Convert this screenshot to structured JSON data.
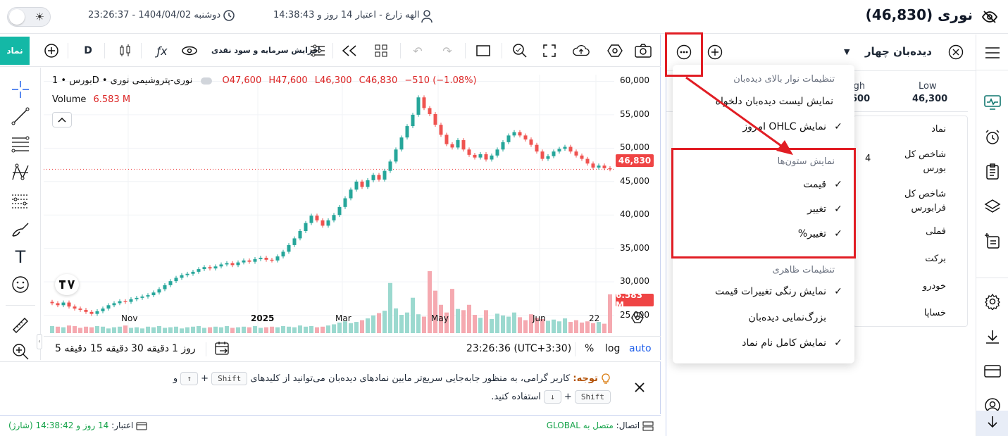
{
  "header": {
    "title": "نوری (46,830)",
    "user": "الهه زارع - اعتبار 14 روز و 14:38:43",
    "datetime": "دوشنبه 1404/04/02 - 23:26:37"
  },
  "toolbar": {
    "namad_label": "نماد",
    "interval": "D",
    "capital_label": "افزایش سرمایه و سود نقدی"
  },
  "chart_legend": {
    "symbol": "بورس • 1D • نوری-پتروشیمی نوری",
    "o": "O47,600",
    "h": "H47,600",
    "l": "L46,300",
    "c": "C46,830",
    "chg": "−510 (−1.08%)",
    "volume_label": "Volume",
    "volume_value": "6.583 M"
  },
  "chart_data": {
    "type": "candlestick",
    "ylim": [
      22000,
      61000
    ],
    "y_ticks": [
      "60,000",
      "55,000",
      "50,000",
      "45,000",
      "40,000",
      "35,000",
      "30,000",
      "25,000"
    ],
    "x_ticks": [
      "Nov",
      "2025",
      "Mar",
      "May",
      "Jun",
      "22"
    ],
    "last_price_label": "46,830",
    "last_volume_label": "6.583 M",
    "close_series": [
      26800,
      26500,
      26900,
      26300,
      26000,
      25800,
      25500,
      25200,
      25600,
      26000,
      26500,
      26800,
      27100,
      27000,
      27400,
      27600,
      27800,
      28000,
      28400,
      28900,
      29500,
      30100,
      30600,
      31000,
      31200,
      31500,
      31900,
      32200,
      32000,
      32300,
      32600,
      32800,
      32500,
      32900,
      33200,
      33000,
      33400,
      33600,
      33300,
      33200,
      33800,
      34500,
      35500,
      36500,
      37600,
      38800,
      39900,
      39200,
      38400,
      39200,
      40000,
      41200,
      42500,
      43800,
      45000,
      44200,
      45200,
      46000,
      45300,
      46600,
      48000,
      49800,
      51600,
      53300,
      55000,
      57600,
      56000,
      55100,
      53500,
      52000,
      50600,
      50100,
      51200,
      49800,
      49000,
      48600,
      49100,
      48300,
      48900,
      49800,
      50900,
      51900,
      52400,
      51900,
      51300,
      50500,
      49500,
      48400,
      48800,
      49500,
      49900,
      50200,
      49500,
      48900,
      48400,
      47700,
      47100,
      47400,
      47000,
      46830
    ],
    "volume_series": [
      1.2,
      1.1,
      1.0,
      1.3,
      1.2,
      0.9,
      1.1,
      1.0,
      1.2,
      1.1,
      0.8,
      1.0,
      1.1,
      1.3,
      0.9,
      1.0,
      0.8,
      1.1,
      1.0,
      1.2,
      0.9,
      1.0,
      1.1,
      0.8,
      1.0,
      1.1,
      1.2,
      0.9,
      1.0,
      1.1,
      1.0,
      1.2,
      0.9,
      1.0,
      1.1,
      1.0,
      1.2,
      0.9,
      1.0,
      1.1,
      1.0,
      1.2,
      1.1,
      1.0,
      1.3,
      1.1,
      1.2,
      1.0,
      1.1,
      1.3,
      1.5,
      1.8,
      2.0,
      1.7,
      1.9,
      2.2,
      2.5,
      3.0,
      3.4,
      3.8,
      8.5,
      4.2,
      3.1,
      3.5,
      6.0,
      3.2,
      2.8,
      10.5,
      7.2,
      4.8,
      3.5,
      7.5,
      4.1,
      3.9,
      4.8,
      3.1,
      2.6,
      3.9,
      2.4,
      3.3,
      3.0,
      2.8,
      3.5,
      2.7,
      2.2,
      3.2,
      2.6,
      2.4,
      2.1,
      2.3,
      2.0,
      2.5,
      1.9,
      2.2,
      1.8,
      2.0,
      1.7,
      1.9,
      1.6,
      6.583
    ]
  },
  "timeframes": [
    "5 دقیقه",
    "15 دقیقه",
    "30 دقیقه",
    "1 روز"
  ],
  "time_display": "23:26:36 (UTC+3:30)",
  "scale": {
    "pct": "%",
    "log": "log",
    "auto": "auto"
  },
  "notice": {
    "title": "توجه:",
    "text1": "کاربر گرامی، به منظور جابه‌جایی سریع‌تر مابین نمادهای دیده‌بان می‌توانید از کلیدهای",
    "text2": "استفاده کنید.",
    "key_shift": "Shift",
    "plus": "+",
    "and": "و",
    "arrow_up": "↑",
    "arrow_down": "↓"
  },
  "status": {
    "connection_label": "اتصال:",
    "connection_value": "متصل به GLOBAL",
    "credit_label": "اعتبار:",
    "credit_value": "14 روز و 14:38:42 (شارژ)"
  },
  "watchlist": {
    "title": "دیده‌بان چهار",
    "col_high_part": "igh",
    "col_low": "Low",
    "high_val_part": "600",
    "low_val": "46,300",
    "col_namad": "نماد",
    "rows": [
      "شاخص کل بورس",
      "شاخص کل فرابورس",
      "فملی",
      "برکت",
      "خودرو",
      "خساپا"
    ],
    "row_fragment": "4"
  },
  "menu": {
    "header1": "تنظیمات نوار بالای دیده‌بان",
    "item1": "نمایش لیست دیده‌بان دلخواه",
    "item2": "نمایش OHLC امروز",
    "header2": "نمایش ستون‌ها",
    "item3": "قیمت",
    "item4": "تغییر",
    "item5": "تغییر%",
    "header3": "تنظیمات ظاهری",
    "item6": "نمایش رنگی تغییرات قیمت",
    "item7": "بزرگ‌نمایی دیده‌بان",
    "item8": "نمایش کامل نام نماد",
    "check": "✓"
  }
}
